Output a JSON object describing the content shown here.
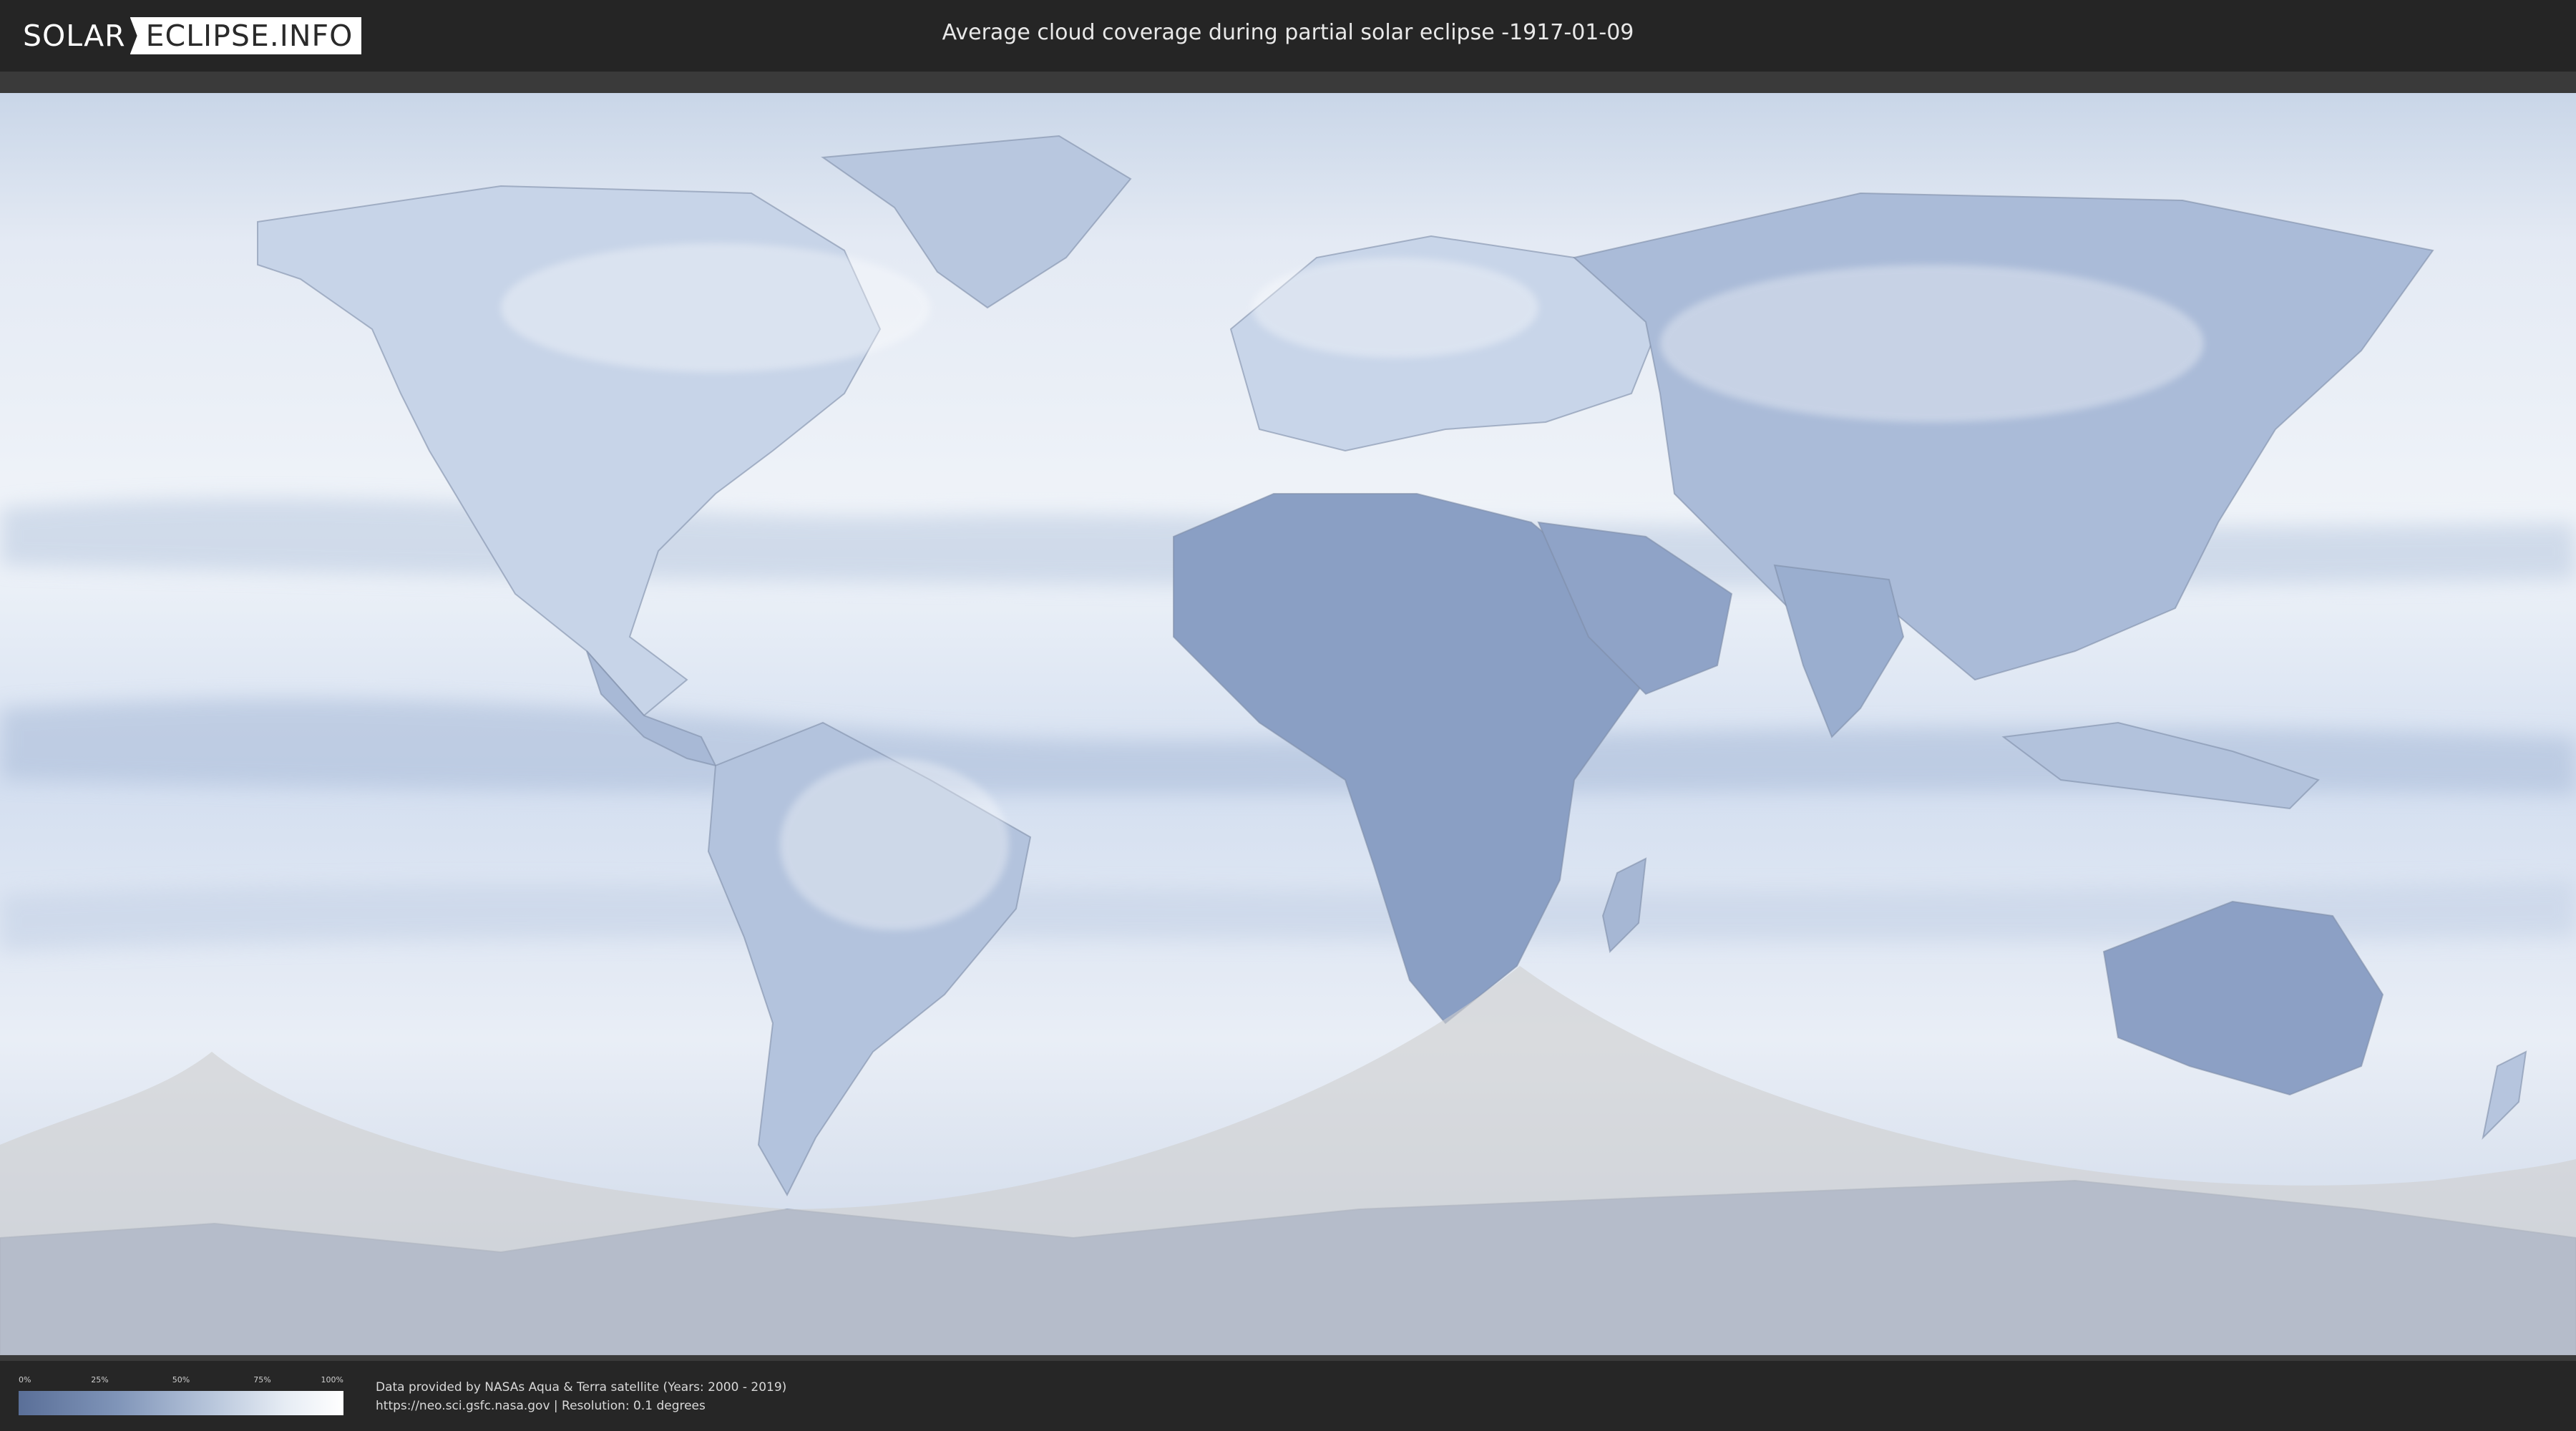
{
  "header": {
    "logo_left": "SOLAR",
    "logo_right": "ECLIPSE.INFO",
    "title": "Average cloud coverage during partial solar eclipse -1917-01-09"
  },
  "legend": {
    "ticks": [
      "0%",
      "25%",
      "50%",
      "75%",
      "100%"
    ],
    "values": [
      0,
      25,
      50,
      75,
      100
    ],
    "gradient_colors": [
      "#5a6f98",
      "#7f94b8",
      "#b9c7dc",
      "#e6ecf4",
      "#ffffff"
    ]
  },
  "footer": {
    "line1": "Data provided by NASAs Aqua & Terra satellite (Years: 2000 - 2019)",
    "line2": "https://neo.sci.gsfc.nasa.gov | Resolution: 0.1 degrees"
  },
  "map": {
    "ocean_color": "#dfe7f2",
    "land_cloud_color": "#8fa3c6",
    "shadow_color": "#d0d0d0"
  }
}
